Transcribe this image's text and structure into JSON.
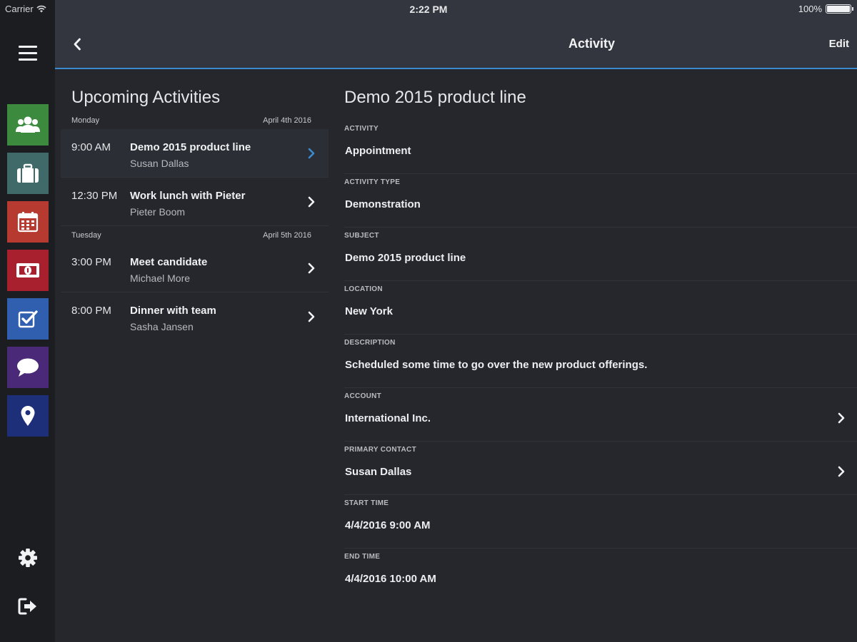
{
  "status_bar": {
    "carrier": "Carrier",
    "time": "2:22 PM",
    "battery": "100%"
  },
  "header": {
    "title": "Activity",
    "edit_label": "Edit"
  },
  "rail": {
    "tiles": [
      {
        "name": "contacts",
        "icon": "people-icon",
        "color": "#3b8a3e"
      },
      {
        "name": "opportunities",
        "icon": "briefcase-icon",
        "color": "#3f6a69"
      },
      {
        "name": "calendar",
        "icon": "calendar-icon",
        "color": "#b73a30"
      },
      {
        "name": "finance",
        "icon": "money-icon",
        "color": "#a8202e"
      },
      {
        "name": "tasks",
        "icon": "checkbox-icon",
        "color": "#2f5fae"
      },
      {
        "name": "messages",
        "icon": "chat-icon",
        "color": "#4a2a78"
      },
      {
        "name": "locations",
        "icon": "location-pin-icon",
        "color": "#1e2f7a"
      }
    ]
  },
  "list": {
    "title": "Upcoming Activities",
    "days": [
      {
        "day": "Monday",
        "date": "April 4th 2016"
      },
      {
        "day": "Tuesday",
        "date": "April 5th 2016"
      }
    ],
    "items": [
      {
        "time": "9:00 AM",
        "title": "Demo 2015 product line",
        "who": "Susan Dallas"
      },
      {
        "time": "12:30 PM",
        "title": "Work lunch with Pieter",
        "who": "Pieter Boom"
      },
      {
        "time": "3:00 PM",
        "title": "Meet candidate",
        "who": "Michael More"
      },
      {
        "time": "8:00 PM",
        "title": "Dinner with team",
        "who": "Sasha Jansen"
      }
    ]
  },
  "detail": {
    "title": "Demo 2015 product line",
    "fields": [
      {
        "label": "ACTIVITY",
        "value": "Appointment"
      },
      {
        "label": "ACTIVITY TYPE",
        "value": "Demonstration"
      },
      {
        "label": "SUBJECT",
        "value": "Demo 2015 product line"
      },
      {
        "label": "LOCATION",
        "value": "New York"
      },
      {
        "label": "DESCRIPTION",
        "value": "Scheduled some time to go over the new product offerings."
      },
      {
        "label": "ACCOUNT",
        "value": "International Inc."
      },
      {
        "label": "PRIMARY CONTACT",
        "value": "Susan Dallas"
      },
      {
        "label": "START TIME",
        "value": "4/4/2016 9:00 AM"
      },
      {
        "label": "END TIME",
        "value": "4/4/2016 10:00 AM"
      }
    ]
  },
  "colors": {
    "accent": "#3a8bd0",
    "background": "#25272d",
    "header": "#33363e",
    "rail": "#1b1d21"
  }
}
